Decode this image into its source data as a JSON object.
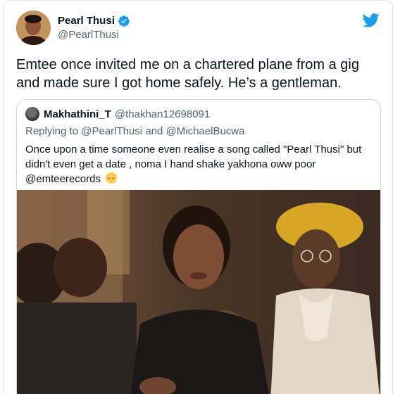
{
  "tweet": {
    "display_name": "Pearl Thusi",
    "handle": "@PearlThusi",
    "text": "Emtee once invited me on a chartered plane from a gig and made sure I got home safely. He’s a gentleman.",
    "icons": {
      "verified": "verified-badge-icon",
      "platform": "twitter-bird-icon"
    },
    "colors": {
      "brand": "#1d9bf0",
      "secondary_text": "#536471",
      "border": "#cfd9de"
    }
  },
  "quoted_tweet": {
    "display_name": "Makhathini_T",
    "handle": "@thakhan12698091",
    "replying_prefix": "Replying to",
    "replying_to_1": "@PearlThusi",
    "replying_and": "and",
    "replying_to_2": "@MichaelBucwa",
    "text_main": "Once upon a time someone even realise a song called \"Pearl Thusi\" but didn't even get a date , noma I hand shake yakhona oww poor",
    "text_mention": "@emteerecords",
    "emoji": "relieved-face-emoji",
    "media": "photo-crying-woman-comforted"
  }
}
